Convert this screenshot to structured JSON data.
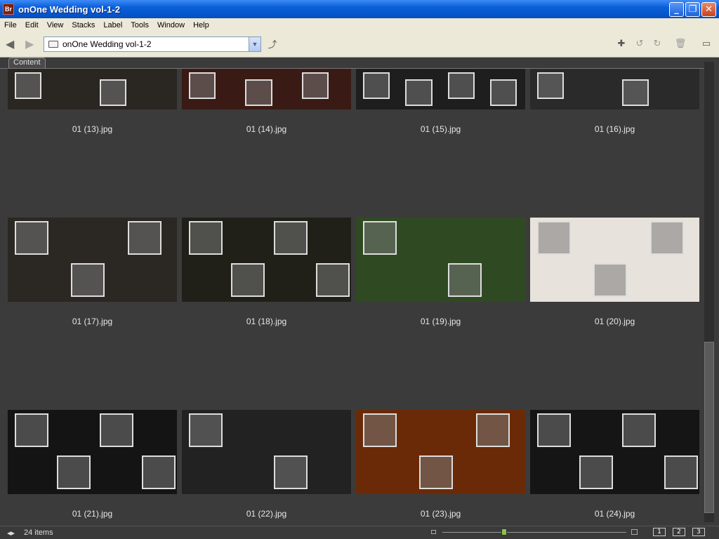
{
  "window": {
    "title": "onOne Wedding vol-1-2",
    "app_icon": "Br"
  },
  "menu": [
    "File",
    "Edit",
    "View",
    "Stacks",
    "Label",
    "Tools",
    "Window",
    "Help"
  ],
  "path": {
    "value": "onOne Wedding vol-1-2"
  },
  "content_tab": "Content",
  "items": [
    {
      "caption": "01 (13).jpg",
      "bg": "#2a2622"
    },
    {
      "caption": "01 (14).jpg",
      "bg": "#3a1a14"
    },
    {
      "caption": "01 (15).jpg",
      "bg": "#1e1e1e"
    },
    {
      "caption": "01 (16).jpg",
      "bg": "#2a2a2a"
    },
    {
      "caption": "01 (17).jpg",
      "bg": "#2b2722"
    },
    {
      "caption": "01 (18).jpg",
      "bg": "#202018"
    },
    {
      "caption": "01 (19).jpg",
      "bg": "#2f4a22"
    },
    {
      "caption": "01 (20).jpg",
      "bg": "#e8e2dc"
    },
    {
      "caption": "01 (21).jpg",
      "bg": "#141414"
    },
    {
      "caption": "01 (22).jpg",
      "bg": "#222222"
    },
    {
      "caption": "01 (23).jpg",
      "bg": "#6a2a08"
    },
    {
      "caption": "01 (24).jpg",
      "bg": "#151515"
    }
  ],
  "status": {
    "count": "24 items",
    "view_buttons": [
      "1",
      "2",
      "3"
    ]
  },
  "colors": {
    "titlebar": "#0553c8",
    "content_bg": "#3b3b3b",
    "slider_knob": "#8bc34a"
  }
}
